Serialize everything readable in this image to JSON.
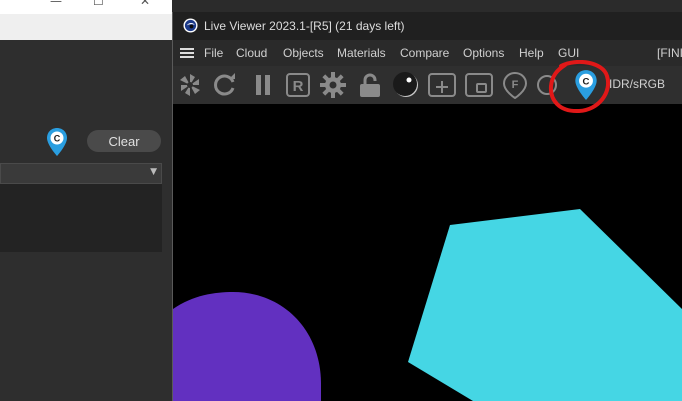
{
  "left_window": {
    "controls": [
      "—",
      "☐",
      "✕"
    ],
    "clear_button": "Clear",
    "pin_letter": "C"
  },
  "live_viewer": {
    "title": "Live Viewer 2023.1-[R5] (21 days left)",
    "menu": [
      "File",
      "Cloud",
      "Objects",
      "Materials",
      "Compare",
      "Options",
      "Help",
      "GUI",
      "[FINIS"
    ],
    "toolbar": {
      "icons": [
        "lens-icon",
        "refresh-icon",
        "pause-icon",
        "region-r-icon",
        "gear-icon",
        "lock-icon",
        "sphere-icon",
        "add-icon",
        "fit-icon",
        "focus-f-icon",
        "pin-icon"
      ],
      "region_letter": "R",
      "focus_letter": "F",
      "pin_letter": "C",
      "color_space": "IDR/sRGB"
    },
    "scene_colors": {
      "hexagon": "#45d6e4",
      "circle": "#6230c0"
    },
    "annotation_color": "#e01818"
  }
}
